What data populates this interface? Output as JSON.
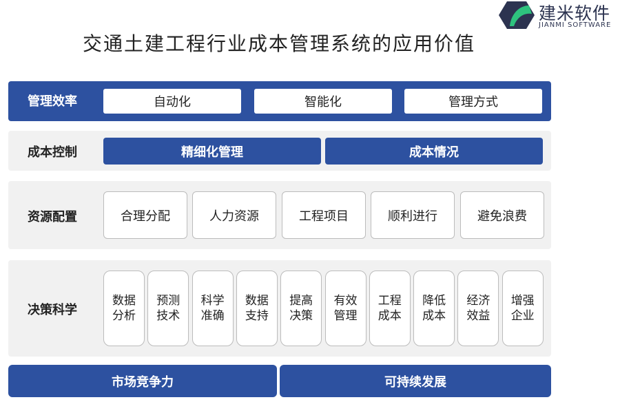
{
  "title": "交通土建工程行业成本管理系统的应用价值",
  "logo": {
    "cn": "建米软件",
    "en": "JIANMI SOFTWARE"
  },
  "colors": {
    "primary": "#2d51a0",
    "panel": "#f1f1f1"
  },
  "rows": [
    {
      "label": "管理效率",
      "items": [
        "自动化",
        "智能化",
        "管理方式"
      ]
    },
    {
      "label": "成本控制",
      "items": [
        "精细化管理",
        "成本情况"
      ]
    },
    {
      "label": "资源配置",
      "items": [
        "合理分配",
        "人力资源",
        "工程项目",
        "顺利进行",
        "避免浪费"
      ]
    },
    {
      "label": "决策科学",
      "items": [
        "数据分析",
        "预测技术",
        "科学准确",
        "数据支持",
        "提高决策",
        "有效管理",
        "工程成本",
        "降低成本",
        "经济效益",
        "增强企业"
      ]
    }
  ],
  "bottom": [
    "市场竞争力",
    "可持续发展"
  ]
}
